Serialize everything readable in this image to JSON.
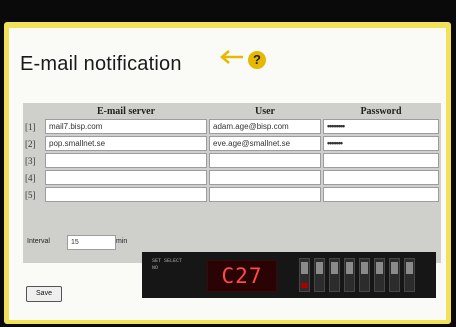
{
  "page": {
    "title": "E-mail notification",
    "help_symbol": "?"
  },
  "table": {
    "headers": [
      "E-mail server",
      "User",
      "Password"
    ],
    "rows": [
      {
        "label": "[1]",
        "server": "mail7.bisp.com",
        "user": "adam.age@bisp.com",
        "password": "••••••••"
      },
      {
        "label": "[2]",
        "server": "pop.smallnet.se",
        "user": "eve.age@smallnet.se",
        "password": "•••••••"
      },
      {
        "label": "[3]",
        "server": "",
        "user": "",
        "password": ""
      },
      {
        "label": "[4]",
        "server": "",
        "user": "",
        "password": ""
      },
      {
        "label": "[5]",
        "server": "",
        "user": "",
        "password": ""
      }
    ]
  },
  "interval": {
    "label": "Interval",
    "value": "15",
    "unit": "min"
  },
  "save_label": "Save",
  "device": {
    "label_line1": "SET SELECT",
    "label_line2": "NO",
    "display": "C27"
  },
  "colors": {
    "frame": "#f1e25a",
    "panel": "#fafaf7",
    "table_bg": "#cfcfcc",
    "help_icon": "#e6b800",
    "arrow": "#e6b800",
    "display_text": "#ff4a4a"
  },
  "icons": {
    "arrow": "arrow-left-icon",
    "help": "help-icon"
  }
}
